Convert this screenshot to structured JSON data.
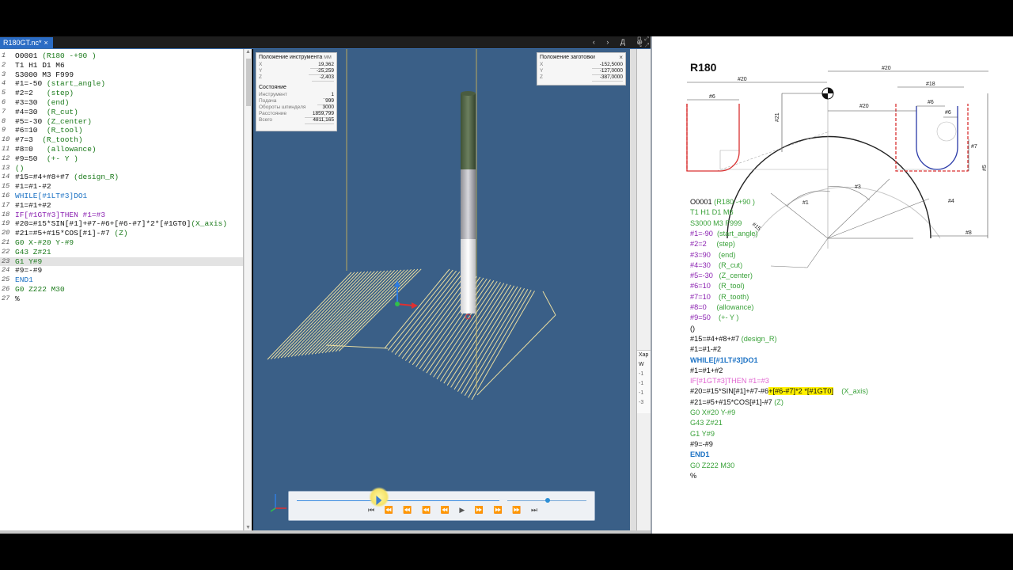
{
  "editor": {
    "tab": {
      "label": "R180GT.nc*",
      "close": "×"
    },
    "tab_nav": "‹ › Д ⊕",
    "lines": [
      {
        "n": "1",
        "parts": [
          {
            "t": "O0001 ",
            "c": "#111"
          },
          {
            "t": "(R180 -+90 )",
            "c": "#1b7a1b"
          }
        ]
      },
      {
        "n": "2",
        "parts": [
          {
            "t": "T1 H1 D1 M6",
            "c": "#111"
          }
        ]
      },
      {
        "n": "3",
        "parts": [
          {
            "t": "S3000 M3 F999",
            "c": "#111"
          }
        ]
      },
      {
        "n": "4",
        "parts": [
          {
            "t": "#1=-50 ",
            "c": "#111"
          },
          {
            "t": "(start_angle)",
            "c": "#1b7a1b"
          }
        ]
      },
      {
        "n": "5",
        "parts": [
          {
            "t": "#2=2   ",
            "c": "#111"
          },
          {
            "t": "(step)",
            "c": "#1b7a1b"
          }
        ]
      },
      {
        "n": "6",
        "parts": [
          {
            "t": "#3=30  ",
            "c": "#111"
          },
          {
            "t": "(end)",
            "c": "#1b7a1b"
          }
        ]
      },
      {
        "n": "7",
        "parts": [
          {
            "t": "#4=30  ",
            "c": "#111"
          },
          {
            "t": "(R_cut)",
            "c": "#1b7a1b"
          }
        ]
      },
      {
        "n": "8",
        "parts": [
          {
            "t": "#5=-30 ",
            "c": "#111"
          },
          {
            "t": "(Z_center)",
            "c": "#1b7a1b"
          }
        ]
      },
      {
        "n": "9",
        "parts": [
          {
            "t": "#6=10  ",
            "c": "#111"
          },
          {
            "t": "(R_tool)",
            "c": "#1b7a1b"
          }
        ]
      },
      {
        "n": "10",
        "parts": [
          {
            "t": "#7=3  ",
            "c": "#111"
          },
          {
            "t": "(R_tooth)",
            "c": "#1b7a1b"
          }
        ]
      },
      {
        "n": "11",
        "parts": [
          {
            "t": "#8=0   ",
            "c": "#111"
          },
          {
            "t": "(allowance)",
            "c": "#1b7a1b"
          }
        ]
      },
      {
        "n": "12",
        "parts": [
          {
            "t": "#9=50  ",
            "c": "#111"
          },
          {
            "t": "(+- Y )",
            "c": "#1b7a1b"
          }
        ]
      },
      {
        "n": "13",
        "parts": [
          {
            "t": "()",
            "c": "#1b7a1b"
          }
        ]
      },
      {
        "n": "14",
        "parts": [
          {
            "t": "#15=#4+#8+#7 ",
            "c": "#111"
          },
          {
            "t": "(design_R)",
            "c": "#1b7a1b"
          }
        ]
      },
      {
        "n": "15",
        "parts": [
          {
            "t": "#1=#1-#2",
            "c": "#111"
          }
        ]
      },
      {
        "n": "16",
        "parts": [
          {
            "t": "WHILE[#1LT#3]DO1",
            "c": "#1c72c4"
          }
        ]
      },
      {
        "n": "17",
        "parts": [
          {
            "t": "#1=#1+#2",
            "c": "#111"
          }
        ]
      },
      {
        "n": "18",
        "parts": [
          {
            "t": "IF[#1GT#3]THEN #1=#3",
            "c": "#8a1fb0"
          }
        ]
      },
      {
        "n": "19",
        "parts": [
          {
            "t": "#20=#15*SIN[#1]+#7-#6+[#6-#7]*2*[#1GT0]",
            "c": "#111"
          },
          {
            "t": "(X_axis)",
            "c": "#1b7a1b"
          }
        ]
      },
      {
        "n": "20",
        "parts": [
          {
            "t": "#21=#5+#15*COS[#1]-#7 ",
            "c": "#111"
          },
          {
            "t": "(Z)",
            "c": "#1b7a1b"
          }
        ]
      },
      {
        "n": "21",
        "parts": [
          {
            "t": "G0 X-#20 Y-#9",
            "c": "#1b7a1b"
          }
        ]
      },
      {
        "n": "22",
        "parts": [
          {
            "t": "G43 Z#21",
            "c": "#1b7a1b"
          }
        ]
      },
      {
        "n": "23",
        "parts": [
          {
            "t": "G1 Y#9",
            "c": "#1b7a1b"
          }
        ],
        "highlight": true
      },
      {
        "n": "24",
        "parts": [
          {
            "t": "#9=-#9",
            "c": "#111"
          }
        ]
      },
      {
        "n": "25",
        "parts": [
          {
            "t": "END1",
            "c": "#1c72c4"
          }
        ]
      },
      {
        "n": "26",
        "parts": [
          {
            "t": "G0 Z222 M30",
            "c": "#1b7a1b"
          }
        ]
      },
      {
        "n": "27",
        "parts": [
          {
            "t": "%",
            "c": "#111"
          }
        ]
      }
    ]
  },
  "tool_position": {
    "title": "Положение инструмента",
    "unit": "мм",
    "x_label": "X",
    "x": "19,362",
    "y_label": "Y",
    "y": "-25,259",
    "z_label": "Z",
    "z": "-2,403",
    "state_title": "Состояние",
    "rows": [
      {
        "label": "Инструмент",
        "value": "1"
      },
      {
        "label": "Подача",
        "value": "999"
      },
      {
        "label": "Обороты шпинделя",
        "value": "3000"
      },
      {
        "label": "Расстояние",
        "value": "1859,799"
      },
      {
        "label": "Всего",
        "value": "4811,165"
      }
    ]
  },
  "blank_position": {
    "title": "Положение заготовки",
    "close": "×",
    "x_label": "X",
    "x": "-152,5000",
    "y_label": "Y",
    "y": "-127,0000",
    "z_label": "Z",
    "z": "-387,0000"
  },
  "player": {
    "progress": 0.4,
    "controls": "⏮ ⏪ ⏪ ⏪ ⏪ ▶ ⏩ ⏩ ⏩ ⏭"
  },
  "dock": {
    "char_title": "Хар",
    "rows": [
      "W",
      "-1",
      "-1",
      "-1",
      "-3"
    ]
  },
  "doc": {
    "title": "R180",
    "dims": {
      "w20_left": "#20",
      "w6_left": "#6",
      "w20_top": "#20",
      "w18": "#18",
      "w20_mid": "#20",
      "w6_right_a": "#6",
      "w6_right_b": "#6",
      "h21": "#21",
      "h7": "#7",
      "h5": "#5",
      "a1": "#1",
      "a3": "#3",
      "r15": "#15",
      "r4": "#4",
      "h8": "#8"
    },
    "lines": [
      [
        {
          "t": "O0001 ",
          "c": "#111"
        },
        {
          "t": "(R180 -+90 )",
          "c": "#3aa23a"
        }
      ],
      [
        {
          "t": "T1 H1 D1 M6",
          "c": "#3aa23a"
        }
      ],
      [
        {
          "t": "S3000 M3 F999",
          "c": "#3aa23a"
        }
      ],
      [
        {
          "t": "#1=-90  ",
          "c": "#8a1fb0"
        },
        {
          "t": "(start_angle)",
          "c": "#3aa23a"
        }
      ],
      [
        {
          "t": "#2=2     ",
          "c": "#8a1fb0"
        },
        {
          "t": "(step)",
          "c": "#3aa23a"
        }
      ],
      [
        {
          "t": "#3=90    ",
          "c": "#8a1fb0"
        },
        {
          "t": "(end)",
          "c": "#3aa23a"
        }
      ],
      [
        {
          "t": "#4=30    ",
          "c": "#8a1fb0"
        },
        {
          "t": "(R_cut)",
          "c": "#3aa23a"
        }
      ],
      [
        {
          "t": "#5=-30   ",
          "c": "#8a1fb0"
        },
        {
          "t": "(Z_center)",
          "c": "#3aa23a"
        }
      ],
      [
        {
          "t": "#6=10    ",
          "c": "#8a1fb0"
        },
        {
          "t": "(R_tool)",
          "c": "#3aa23a"
        }
      ],
      [
        {
          "t": "#7=10    ",
          "c": "#8a1fb0"
        },
        {
          "t": "(R_tooth)",
          "c": "#3aa23a"
        }
      ],
      [
        {
          "t": "#8=0     ",
          "c": "#8a1fb0"
        },
        {
          "t": "(allowance)",
          "c": "#3aa23a"
        }
      ],
      [
        {
          "t": "#9=50    ",
          "c": "#8a1fb0"
        },
        {
          "t": "(+- Y )",
          "c": "#3aa23a"
        }
      ],
      [
        {
          "t": "()",
          "c": "#111"
        }
      ],
      [
        {
          "t": "#15=#4+#8+#7 ",
          "c": "#111"
        },
        {
          "t": "(design_R)",
          "c": "#3aa23a"
        }
      ],
      [
        {
          "t": "#1=#1-#2",
          "c": "#111"
        }
      ],
      [
        {
          "t": "WHILE[#1LT#3]DO1",
          "c": "#1c72c4",
          "b": true
        }
      ],
      [
        {
          "t": "#1=#1+#2",
          "c": "#111"
        }
      ],
      [
        {
          "t": "IF[#1GT#3]THEN #1=#3",
          "c": "#e066d0"
        }
      ],
      [
        {
          "t": "#20=#15*SIN[#1]+#7-#6",
          "c": "#111"
        },
        {
          "t": "+[#6-#7]*2 *[#1GT0]",
          "c": "#111",
          "hl": true
        },
        {
          "t": "    (X_axis)",
          "c": "#3aa23a"
        }
      ],
      [
        {
          "t": "#21=#5+#15*COS[#1]-#7 ",
          "c": "#111"
        },
        {
          "t": "(Z)",
          "c": "#3aa23a"
        }
      ],
      [
        {
          "t": "G0 X#20 Y-#9",
          "c": "#3aa23a"
        }
      ],
      [
        {
          "t": "G43 Z#21",
          "c": "#3aa23a"
        }
      ],
      [
        {
          "t": "G1 Y#9",
          "c": "#3aa23a"
        }
      ],
      [
        {
          "t": "#9=-#9",
          "c": "#111"
        }
      ],
      [
        {
          "t": "END1",
          "c": "#1c72c4",
          "b": true
        }
      ],
      [
        {
          "t": "G0 Z222 M30",
          "c": "#3aa23a"
        }
      ],
      [
        {
          "t": "%",
          "c": "#111"
        }
      ]
    ]
  }
}
